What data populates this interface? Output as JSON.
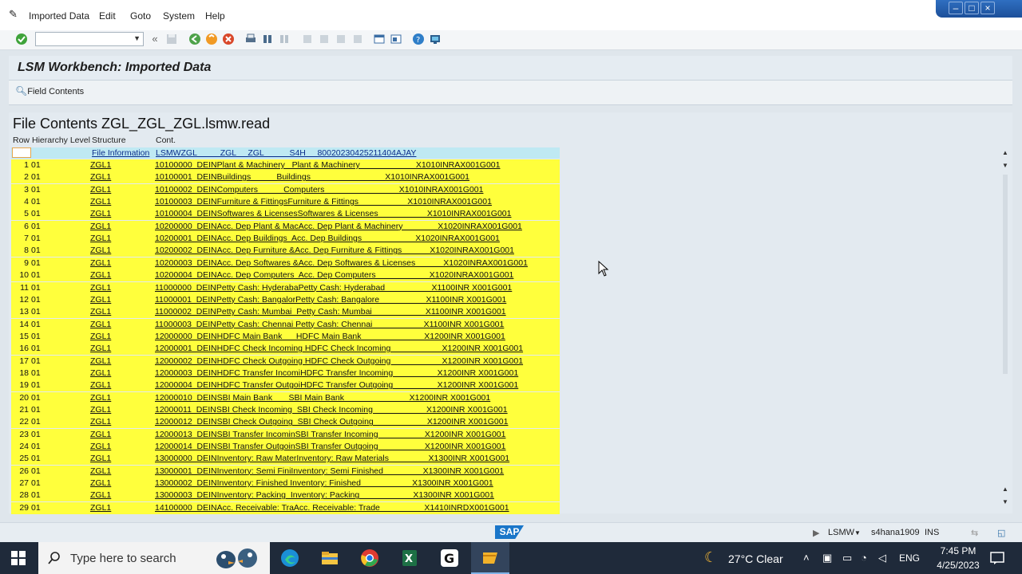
{
  "menu": {
    "items": [
      "Imported Data",
      "Edit",
      "Goto",
      "System",
      "Help"
    ]
  },
  "toolbar": {
    "command_field": ""
  },
  "page": {
    "title": "LSM Workbench: Imported Data"
  },
  "appbar": {
    "field_contents_label": "Field Contents"
  },
  "file": {
    "heading": "File Contents ZGL_ZGL_ZGL.lsmw.read"
  },
  "table": {
    "headers": {
      "row": "Row",
      "level": "Hierarchy Level",
      "structure": "Structure",
      "cont": "Cont."
    },
    "file_info": {
      "structure": "File Information",
      "cont": "LSMWZGL          ZGL     ZGL           S4H     80020230425211404AJAY"
    },
    "rows": [
      [
        "1",
        "01",
        "ZGL1",
        "10100000  DEINPlant & Machinery   Plant & Machinery                        X1010INRAX001G001"
      ],
      [
        "2",
        "01",
        "ZGL1",
        "10100001  DEINBuildings           Buildings                                X1010INRAX001G001"
      ],
      [
        "3",
        "01",
        "ZGL1",
        "10100002  DEINComputers           Computers                                X1010INRAX001G001"
      ],
      [
        "4",
        "01",
        "ZGL1",
        "10100003  DEINFurniture & FittingsFurniture & Fittings                     X1010INRAX001G001"
      ],
      [
        "5",
        "01",
        "ZGL1",
        "10100004  DEINSoftwares & LicensesSoftwares & Licenses                     X1010INRAX001G001"
      ],
      [
        "6",
        "01",
        "ZGL1",
        "10200000  DEINAcc. Dep Plant & MacAcc. Dep Plant & Machinery               X1020INRAX001G001"
      ],
      [
        "7",
        "01",
        "ZGL1",
        "10200001  DEINAcc. Dep Buildings  Acc. Dep Buildings                       X1020INRAX001G001"
      ],
      [
        "8",
        "01",
        "ZGL1",
        "10200002  DEINAcc. Dep Furniture &Acc. Dep Furniture & Fittings            X1020INRAX001G001"
      ],
      [
        "9",
        "01",
        "ZGL1",
        "10200003  DEINAcc. Dep Softwares &Acc. Dep Softwares & Licenses            X1020INRAX001G001"
      ],
      [
        "10",
        "01",
        "ZGL1",
        "10200004  DEINAcc. Dep Computers  Acc. Dep Computers                       X1020INRAX001G001"
      ],
      [
        "11",
        "01",
        "ZGL1",
        "11000000  DEINPetty Cash: HyderabaPetty Cash: Hyderabad                    X1100INR X001G001"
      ],
      [
        "12",
        "01",
        "ZGL1",
        "11000001  DEINPetty Cash: BangalorPetty Cash: Bangalore                    X1100INR X001G001"
      ],
      [
        "13",
        "01",
        "ZGL1",
        "11000002  DEINPetty Cash: Mumbai  Petty Cash: Mumbai                       X1100INR X001G001"
      ],
      [
        "14",
        "01",
        "ZGL1",
        "11000003  DEINPetty Cash: Chennai Petty Cash: Chennai                      X1100INR X001G001"
      ],
      [
        "15",
        "01",
        "ZGL1",
        "12000000  DEINHDFC Main Bank      HDFC Main Bank                           X1200INR X001G001"
      ],
      [
        "16",
        "01",
        "ZGL1",
        "12000001  DEINHDFC Check Incoming HDFC Check Incoming                      X1200INR X001G001"
      ],
      [
        "17",
        "01",
        "ZGL1",
        "12000002  DEINHDFC Check Outgoing HDFC Check Outgoing                      X1200INR X001G001"
      ],
      [
        "18",
        "01",
        "ZGL1",
        "12000003  DEINHDFC Transfer IncomiHDFC Transfer Incoming                   X1200INR X001G001"
      ],
      [
        "19",
        "01",
        "ZGL1",
        "12000004  DEINHDFC Transfer OutgoiHDFC Transfer Outgoing                   X1200INR X001G001"
      ],
      [
        "20",
        "01",
        "ZGL1",
        "12000010  DEINSBI Main Bank       SBI Main Bank                            X1200INR X001G001"
      ],
      [
        "21",
        "01",
        "ZGL1",
        "12000011  DEINSBI Check Incoming  SBI Check Incoming                       X1200INR X001G001"
      ],
      [
        "22",
        "01",
        "ZGL1",
        "12000012  DEINSBI Check Outgoing  SBI Check Outgoing                       X1200INR X001G001"
      ],
      [
        "23",
        "01",
        "ZGL1",
        "12000013  DEINSBI Transfer IncominSBI Transfer Incoming                    X1200INR X001G001"
      ],
      [
        "24",
        "01",
        "ZGL1",
        "12000014  DEINSBI Transfer OutgoinSBI Transfer Outgoing                    X1200INR X001G001"
      ],
      [
        "25",
        "01",
        "ZGL1",
        "13000000  DEINInventory: Raw MaterInventory: Raw Materials                 X1300INR X001G001"
      ],
      [
        "26",
        "01",
        "ZGL1",
        "13000001  DEINInventory: Semi FiniInventory: Semi Finished                 X1300INR X001G001"
      ],
      [
        "27",
        "01",
        "ZGL1",
        "13000002  DEINInventory: Finished Inventory: Finished                      X1300INR X001G001"
      ],
      [
        "28",
        "01",
        "ZGL1",
        "13000003  DEINInventory: Packing  Inventory: Packing                       X1300INR X001G001"
      ],
      [
        "29",
        "01",
        "ZGL1",
        "14100000  DEINAcc. Receivable: TraAcc. Receivable: Trade                   X1410INRDX001G001"
      ]
    ]
  },
  "status": {
    "transaction": "LSMW",
    "system": "s4hana1909",
    "mode": "INS",
    "logo": "SAP"
  },
  "taskbar": {
    "search_placeholder": "Type here to search",
    "weather": "27°C  Clear",
    "language": "ENG",
    "time": "7:45 PM",
    "date": "4/25/2023"
  },
  "colors": {
    "row_yellow": "#ffff3c",
    "file_info_row": "#bfe9f3",
    "taskbar": "#1f2a3a",
    "sap_blue": "#1a76c9"
  }
}
